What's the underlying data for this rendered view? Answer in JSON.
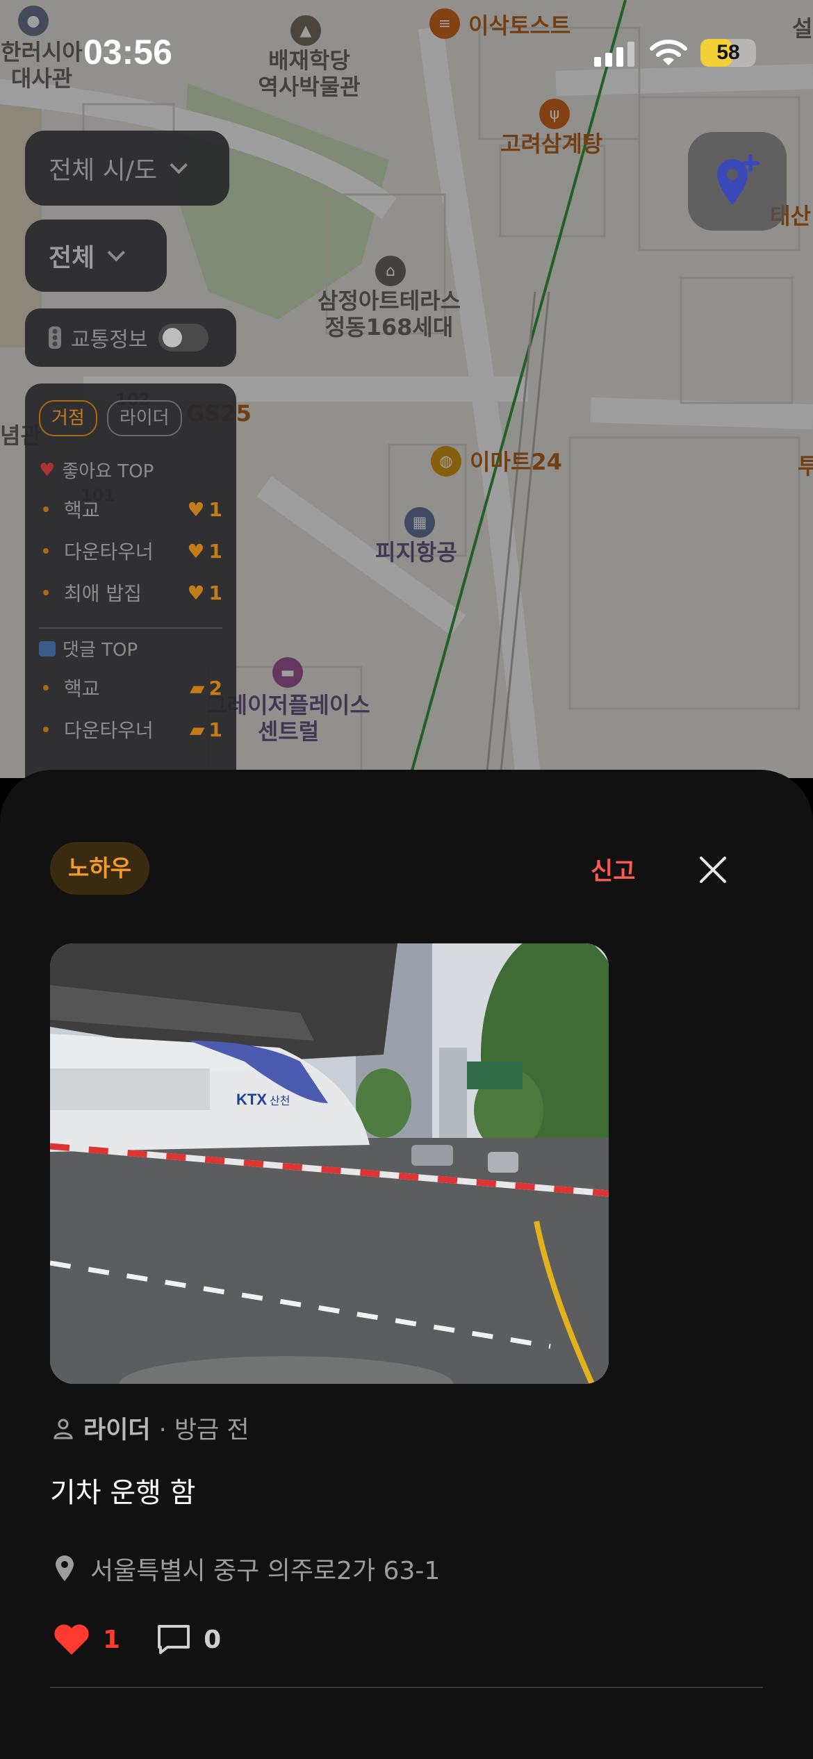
{
  "status_bar": {
    "time": "03:56",
    "battery": "58",
    "battery_level": 0.58
  },
  "map": {
    "pois": [
      {
        "label": "한러시아\n대사관"
      },
      {
        "label": "배재학당\n역사박물관"
      },
      {
        "label": "이삭토스트"
      },
      {
        "label": "고려삼계탕"
      },
      {
        "label": "태산"
      },
      {
        "label": "삼정아트테라스\n정동168세대"
      },
      {
        "label": "GS25"
      },
      {
        "label": "이마트24"
      },
      {
        "label": "피지항공"
      },
      {
        "label": "그레이저플레이스\n센트럴"
      },
      {
        "label": "념관"
      },
      {
        "label": "102"
      },
      {
        "label": "101"
      },
      {
        "label": "투"
      },
      {
        "label": "설"
      }
    ]
  },
  "filters": {
    "region": "전체 시/도",
    "scope": "전체",
    "traffic": "교통정보"
  },
  "ranking": {
    "tabs": [
      {
        "label": "거점",
        "active": true
      },
      {
        "label": "라이더",
        "active": false
      }
    ],
    "likes": {
      "title": "좋아요 TOP",
      "items": [
        {
          "name": "핵교",
          "count": "1"
        },
        {
          "name": "다운타우너",
          "count": "1"
        },
        {
          "name": "최애 밥집",
          "count": "1"
        }
      ]
    },
    "comments": {
      "title": "댓글 TOP",
      "items": [
        {
          "name": "핵교",
          "count": "2"
        },
        {
          "name": "다운타우너",
          "count": "1"
        }
      ]
    }
  },
  "post": {
    "category": "노하우",
    "report": "신고",
    "author": "라이더",
    "time": "· 방금 전",
    "content": "기차 운행 함",
    "address": "서울특별시 중구 의주로2가 63-1",
    "likes": "1",
    "comments": "0",
    "photo_text": {
      "train_logo": "KTX",
      "train_sub": "산천"
    }
  },
  "colors": {
    "accent": "#f29a2e",
    "report": "#ff5a4e",
    "like": "#ff3b30",
    "sheet_bg": "#111111"
  }
}
